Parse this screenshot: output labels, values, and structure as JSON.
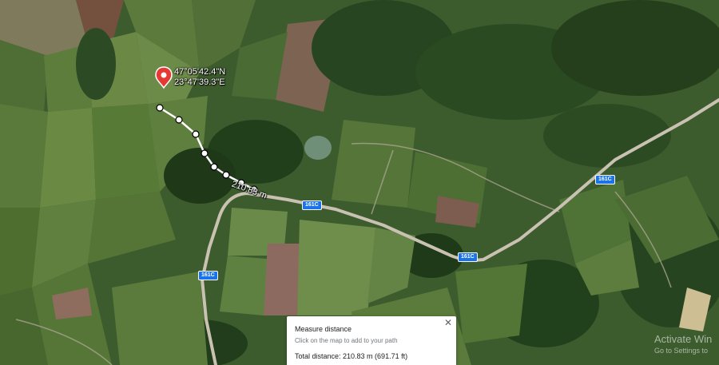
{
  "map": {
    "type": "satellite",
    "colors": {
      "forest": "#1f3a19",
      "field_light": "#6d8c47",
      "field_mid": "#4d6e35",
      "plowed": "#8d6a5f",
      "road": "#c9c2b2",
      "road_shield": "#1a73e8"
    }
  },
  "marker": {
    "icon": "red-location-pin",
    "lat": "47°05'42.4\"N",
    "lng": "23°47'39.3\"E"
  },
  "measure_path": {
    "label": "210.83 m"
  },
  "route_labels": {
    "r1": "161C",
    "r2": "161C",
    "r3": "161C",
    "r4": "161C"
  },
  "panel": {
    "title": "Measure distance",
    "hint": "Click on the map to add to your path",
    "total": "Total distance: 210.83 m (691.71 ft)",
    "close_icon": "close-icon",
    "close_glyph": "✕"
  },
  "watermark": {
    "line1": "Activate Win",
    "line2": "Go to Settings to"
  }
}
